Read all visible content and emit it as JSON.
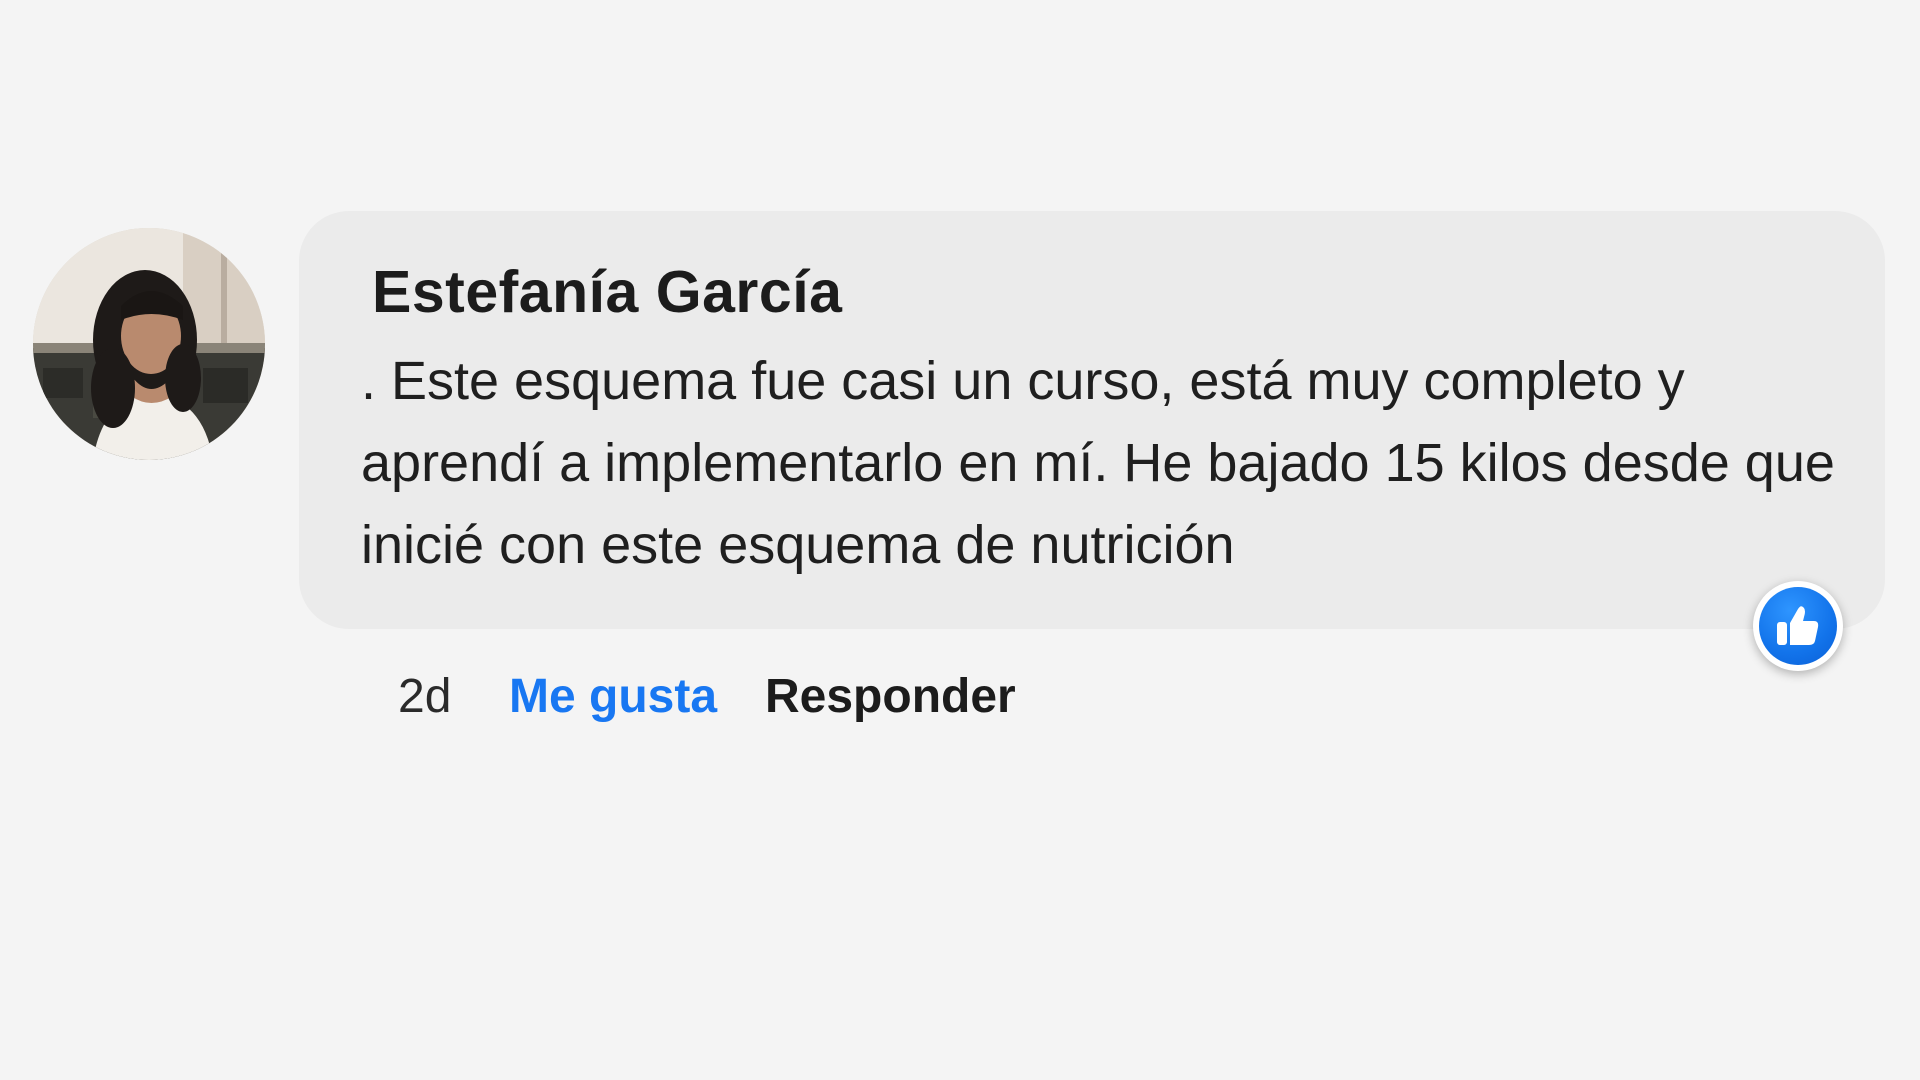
{
  "comment": {
    "author": "Estefanía García",
    "text": ". Este esquema fue casi un curso, está muy completo y aprendí a implementarlo en mí. He bajado 15 kilos desde que inicié con este esquema de nutrición",
    "time": "2d",
    "like_label": "Me gusta",
    "reply_label": "Responder",
    "reaction_icon": "thumbs-up-icon",
    "avatar_icon": "user-avatar"
  },
  "colors": {
    "background": "#f4f4f4",
    "bubble": "#ebebeb",
    "like": "#1877f2",
    "reaction": "#1273ea"
  }
}
